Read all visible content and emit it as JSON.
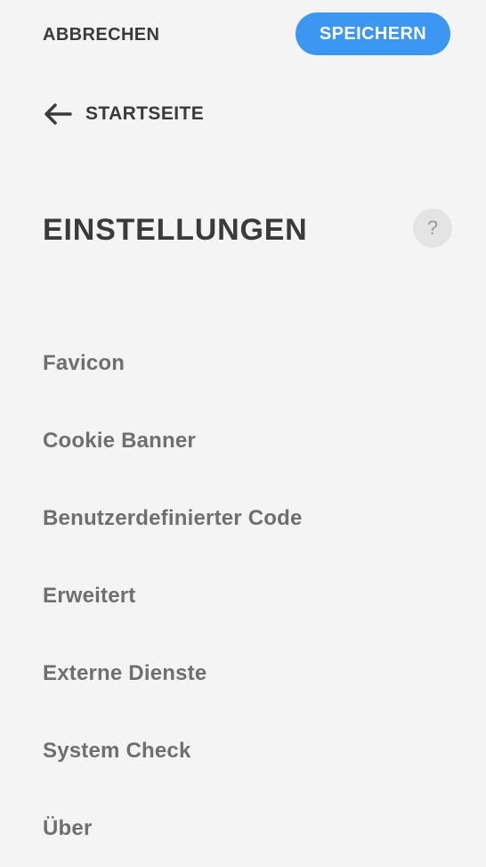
{
  "toolbar": {
    "cancel_label": "ABBRECHEN",
    "save_label": "SPEICHERN"
  },
  "nav": {
    "back_label": "STARTSEITE",
    "back_icon": "arrow-left-icon"
  },
  "header": {
    "title": "EINSTELLUNGEN",
    "help_label": "?"
  },
  "menu": {
    "items": [
      {
        "label": "Favicon"
      },
      {
        "label": "Cookie Banner"
      },
      {
        "label": "Benutzerdefinierter Code"
      },
      {
        "label": "Erweitert"
      },
      {
        "label": "Externe Dienste"
      },
      {
        "label": "System Check"
      },
      {
        "label": "Über"
      }
    ]
  },
  "colors": {
    "background": "#f4f4f4",
    "accent": "#3b97f2",
    "heading_text": "#3a3a3a",
    "menu_text": "#6f6f6f",
    "help_bg": "#e4e4e4"
  }
}
